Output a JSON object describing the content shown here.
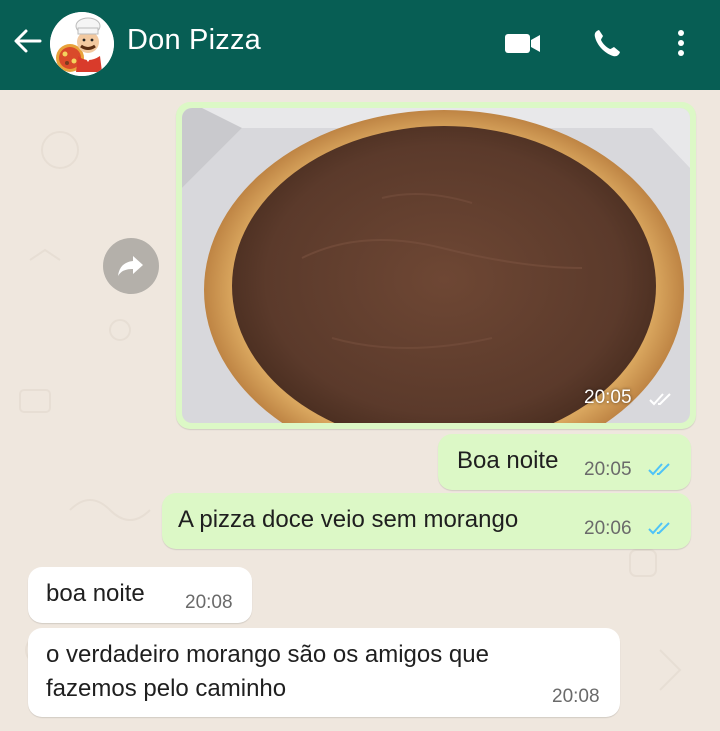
{
  "header": {
    "contact_name": "Don Pizza",
    "bar_color": "#075e54",
    "icons": [
      "back-arrow-icon",
      "video-call-icon",
      "phone-icon",
      "more-vert-icon"
    ]
  },
  "messages": [
    {
      "type": "image",
      "direction": "outgoing",
      "time": "20:05",
      "status": "read"
    },
    {
      "type": "text",
      "direction": "outgoing",
      "text": "Boa noite",
      "time": "20:05",
      "status": "read"
    },
    {
      "type": "text",
      "direction": "outgoing",
      "text": "A pizza doce veio sem morango",
      "time": "20:06",
      "status": "read"
    },
    {
      "type": "text",
      "direction": "incoming",
      "text": "boa noite",
      "time": "20:08"
    },
    {
      "type": "text",
      "direction": "incoming",
      "text": "o verdadeiro morango são os amigos que\nfazemos pelo caminho",
      "time": "20:08"
    }
  ],
  "colors": {
    "outgoing_bubble": "#dcf8c6",
    "incoming_bubble": "#ffffff",
    "read_ticks": "#4fc3f7",
    "chat_background": "#efe7de"
  }
}
